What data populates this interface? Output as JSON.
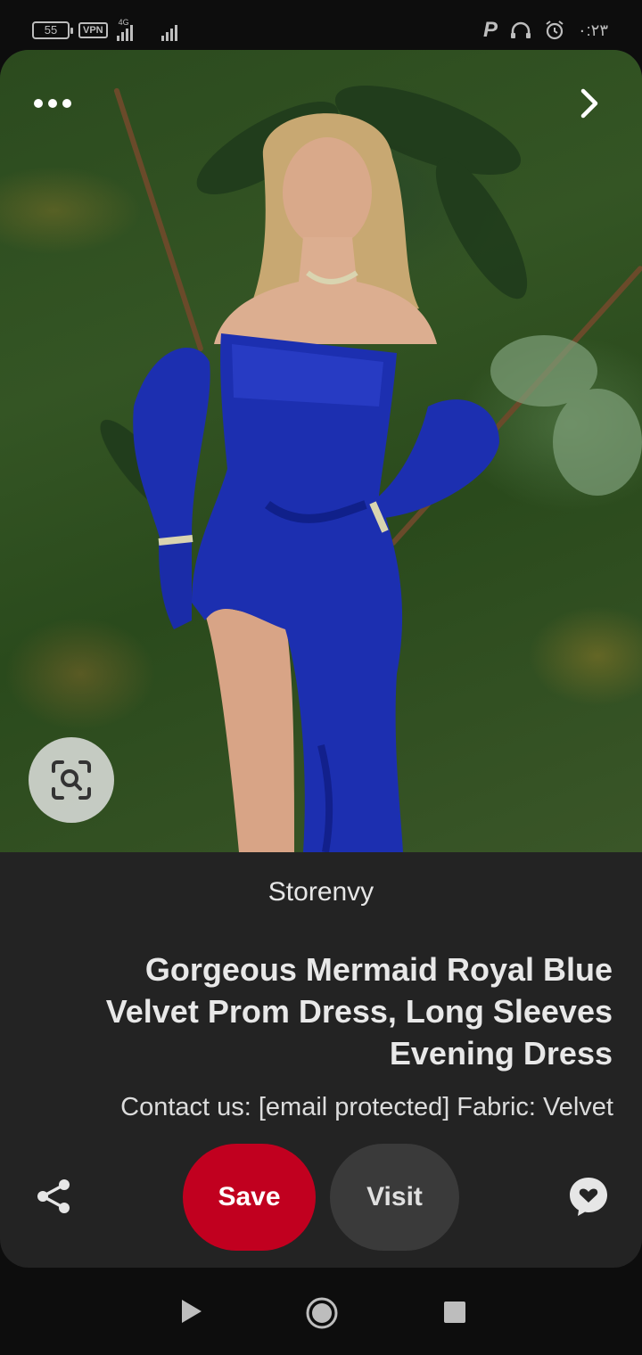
{
  "status_bar": {
    "battery": "55",
    "vpn": "VPN",
    "network": "4G",
    "time": "٠:٢٣"
  },
  "pin": {
    "source": "Storenvy",
    "title": "Gorgeous Mermaid Royal Blue Velvet Prom Dress, Long Sleeves Evening Dress",
    "description": "Contact us: [email protected] Fabric: Velvet"
  },
  "actions": {
    "save_label": "Save",
    "visit_label": "Visit"
  },
  "icons": {
    "more": "more-horizontal-icon",
    "next": "chevron-right-icon",
    "lens": "visual-search-icon",
    "share": "share-icon",
    "comment": "comment-icon"
  },
  "colors": {
    "save": "#c1001f",
    "visit": "#3a3a3a",
    "card": "#232323",
    "dress": "#1c2fb0"
  }
}
